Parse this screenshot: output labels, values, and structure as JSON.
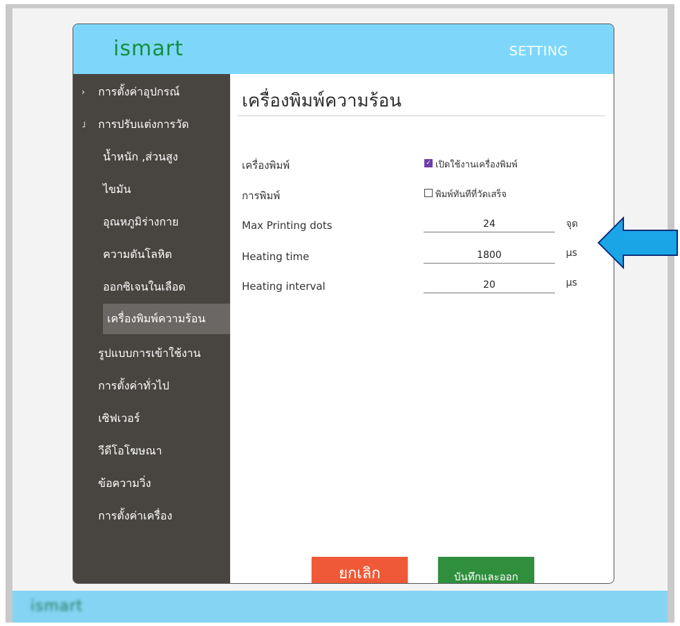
{
  "header": {
    "logo": "ismart",
    "title": "SETTING"
  },
  "sidebar": {
    "items": [
      {
        "label": "การตั้งค่าอุปกรณ์",
        "marker": "›"
      },
      {
        "label": "การปรับแต่งการวัด",
        "marker": "˩"
      },
      {
        "label": "น้ำหนัก ,ส่วนสูง"
      },
      {
        "label": "ไขมัน"
      },
      {
        "label": "อุณหภูมิร่างกาย"
      },
      {
        "label": "ความดันโลหิต"
      },
      {
        "label": "ออกซิเจนในเลือด"
      },
      {
        "label": "เครื่องพิมพ์ความร้อน",
        "active": true
      },
      {
        "label": "รูปแบบการเข้าใช้งาน"
      },
      {
        "label": "การตั้งค่าทั่วไป"
      },
      {
        "label": "เซิฟเวอร์"
      },
      {
        "label": "วีดีโอโฆษณา"
      },
      {
        "label": "ข้อความวิ่ง"
      },
      {
        "label": "การตั้งค่าเครื่อง"
      }
    ]
  },
  "main": {
    "title": "เครื่องพิมพ์ความร้อน",
    "printer": {
      "label": "เครื่องพิมพ์",
      "checkbox_label": "เปิดใช้งานเครื่องพิมพ์",
      "checked": true
    },
    "printing": {
      "label": "การพิมพ์",
      "checkbox_label": "พิมพ์ทันทีที่วัดเสร็จ",
      "checked": false
    },
    "fields": [
      {
        "label": "Max Printing dots",
        "value": "24",
        "unit": "จุด"
      },
      {
        "label": "Heating time",
        "value": "1800",
        "unit": "μs"
      },
      {
        "label": "Heating interval",
        "value": "20",
        "unit": "μs"
      }
    ],
    "buttons": {
      "cancel": "ยกเลิก",
      "save": "บันทึกและออก"
    }
  },
  "footer": {
    "logo": "ismart"
  },
  "colors": {
    "header_bg": "#7ed7fb",
    "sidebar_bg": "#484541",
    "sidebar_active": "#6a6764",
    "cancel": "#ef5937",
    "save": "#2f8f3d",
    "arrow": "#1aa6e6"
  }
}
